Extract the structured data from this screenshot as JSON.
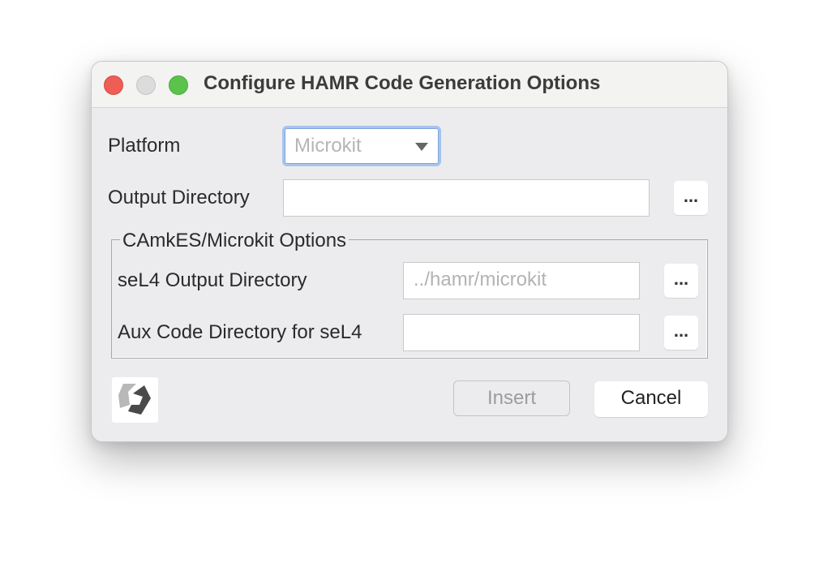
{
  "window": {
    "title": "Configure HAMR Code Generation Options"
  },
  "platform": {
    "label": "Platform",
    "selected": "Microkit"
  },
  "output_directory": {
    "label": "Output Directory",
    "value": "",
    "browse_label": "..."
  },
  "camkes_group": {
    "title": "CAmkES/Microkit Options",
    "sel4_output": {
      "label": "seL4 Output Directory",
      "placeholder": "../hamr/microkit",
      "browse_label": "..."
    },
    "aux_code": {
      "label": "Aux Code Directory for seL4",
      "value": "",
      "browse_label": "..."
    }
  },
  "buttons": {
    "insert": "Insert",
    "cancel": "Cancel"
  },
  "colors": {
    "close": "#ee5e55",
    "minimize": "#dcdcdc",
    "maximize": "#5bc34b",
    "focus_ring": "#a7c4ed"
  }
}
